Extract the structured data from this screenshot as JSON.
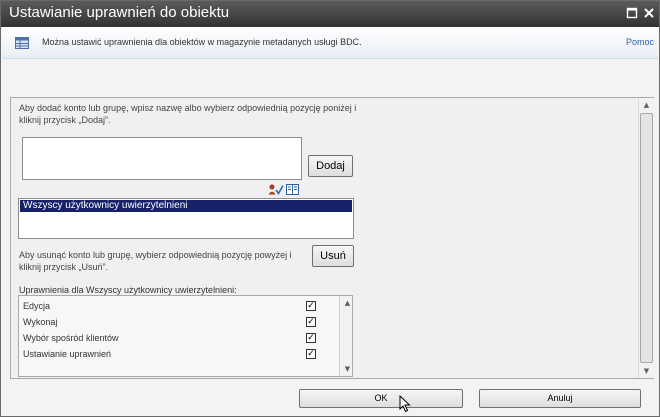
{
  "window": {
    "title": "Ustawianie uprawnień do obiektu",
    "maximize_icon": "maximize-icon",
    "close_icon": "close-icon"
  },
  "infobar": {
    "icon": "table-icon",
    "text": "Można ustawić uprawnienia dla obiektów w magazynie metadanych usługi BDC.",
    "help_link": "Pomoc"
  },
  "add_section": {
    "help_text": "Aby dodać konto lub grupę, wpisz nazwę albo wybierz odpowiednią pozycję poniżej i kliknij przycisk „Dodaj”.",
    "input_value": "",
    "add_button": "Dodaj",
    "check_names_icon": "check-names-icon",
    "address_book_icon": "address-book-icon"
  },
  "users_list": {
    "items": [
      "Wszyscy użytkownicy uwierzytelnieni"
    ],
    "selected_index": 0
  },
  "remove_section": {
    "help_text": "Aby usunąć konto lub grupę, wybierz odpowiednią pozycję powyżej i kliknij przycisk „Usuń”.",
    "remove_button": "Usuń"
  },
  "permissions": {
    "label": "Uprawnienia dla Wszyscy użytkownicy uwierzytelnieni:",
    "items": [
      {
        "label": "Edycja",
        "checked": true
      },
      {
        "label": "Wykonaj",
        "checked": true
      },
      {
        "label": "Wybór spośród klientów",
        "checked": true
      },
      {
        "label": "Ustawianie uprawnień",
        "checked": true
      }
    ]
  },
  "footer": {
    "ok_button": "OK",
    "cancel_button": "Anuluj"
  },
  "colors": {
    "titlebar": "#3d3d3d",
    "selection": "#16216a",
    "link": "#2b5ea9"
  }
}
